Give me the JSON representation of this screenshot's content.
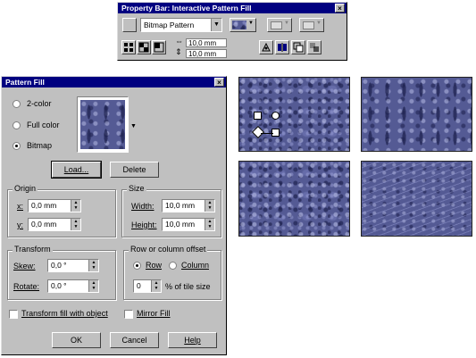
{
  "property_bar": {
    "title": "Property Bar: Interactive Pattern Fill",
    "close_glyph": "×",
    "fill_type": "Bitmap Pattern",
    "tile_width": "10,0 mm",
    "tile_height": "10,0 mm",
    "pattern_color": "#5a5f9a"
  },
  "dialog": {
    "title": "Pattern Fill",
    "close_glyph": "×",
    "radio_2color": "2-color",
    "radio_full_color": "Full color",
    "radio_bitmap": "Bitmap",
    "load_button": "Load...",
    "delete_button": "Delete",
    "origin": {
      "title": "Origin",
      "x_label": "x:",
      "x_value": "0,0 mm",
      "y_label": "y:",
      "y_value": "0,0 mm"
    },
    "size": {
      "title": "Size",
      "width_label": "Width:",
      "width_value": "10,0 mm",
      "height_label": "Height:",
      "height_value": "10,0 mm"
    },
    "transform": {
      "title": "Transform",
      "skew_label": "Skew:",
      "skew_value": "0,0 °",
      "rotate_label": "Rotate:",
      "rotate_value": "0,0 °"
    },
    "offset": {
      "title": "Row or column offset",
      "row_label": "Row",
      "column_label": "Column",
      "percent_value": "0",
      "percent_label": "% of tile size"
    },
    "transform_fill_label": "Transform fill with object",
    "mirror_fill_label": "Mirror Fill",
    "ok_button": "OK",
    "cancel_button": "Cancel",
    "help_button": "Help"
  }
}
